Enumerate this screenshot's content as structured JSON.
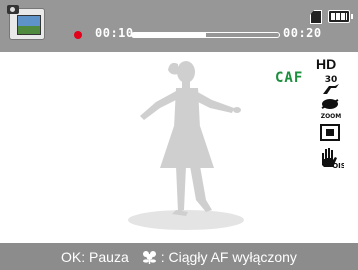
{
  "status": {
    "elapsed_time": "00:10",
    "total_time": "00:20",
    "progress_fraction": 0.5,
    "recording": true
  },
  "indicators": {
    "resolution_label": "HD",
    "focus_mode_label": "CAF",
    "frame_rate_label": "30",
    "icons": [
      "frame-rate-icon",
      "zoom-sound-icon",
      "metering-icon",
      "ois-icon"
    ]
  },
  "guide": {
    "ok_key": "OK",
    "ok_action": ": Pauza",
    "macro_action": ": Ciągły AF wyłączony"
  },
  "colors": {
    "bar": "#979797",
    "record": "#e3001b",
    "focus_indicator": "#1a8f3c"
  }
}
